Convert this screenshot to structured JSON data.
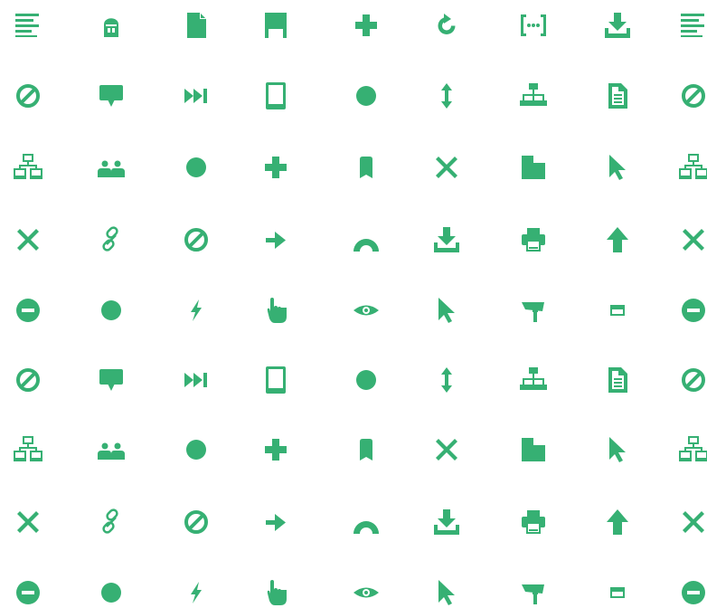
{
  "colors": {
    "icon": "#36b073",
    "background": "#ffffff"
  },
  "grid": {
    "rows": [
      [
        "align-left-icon",
        "robot-head-icon",
        "file-icon",
        "flag-icon",
        "plus-icon",
        "refresh-icon",
        "json-brackets-icon",
        "download-icon",
        "align-left-icon"
      ],
      [
        "ban-icon",
        "speech-bubble-icon",
        "fast-forward-icon",
        "tablet-icon",
        "circle-icon",
        "vertical-resize-icon",
        "sitemap-icon",
        "document-text-icon",
        "ban-icon"
      ],
      [
        "network-icon",
        "group-icon",
        "circle-icon",
        "plus-icon",
        "bookmark-icon",
        "close-icon",
        "folder-file-icon",
        "cursor-icon",
        "network-icon"
      ],
      [
        "close-icon",
        "link-icon",
        "ban-icon",
        "arrow-right-icon",
        "opencart-icon",
        "download-icon",
        "printer-icon",
        "arrow-up-icon",
        "close-icon"
      ],
      [
        "minus-circle-icon",
        "circle-icon",
        "flash-icon",
        "hand-pointer-icon",
        "eye-icon",
        "cursor-icon",
        "security-camera-icon",
        "window-icon",
        "minus-circle-icon"
      ],
      [
        "ban-icon",
        "speech-bubble-icon",
        "fast-forward-icon",
        "tablet-icon",
        "circle-icon",
        "vertical-resize-icon",
        "sitemap-icon",
        "document-text-icon",
        "ban-icon"
      ],
      [
        "network-icon",
        "group-icon",
        "circle-icon",
        "plus-icon",
        "bookmark-icon",
        "close-icon",
        "folder-file-icon",
        "cursor-icon",
        "network-icon"
      ],
      [
        "close-icon",
        "link-icon",
        "ban-icon",
        "arrow-right-icon",
        "opencart-icon",
        "download-icon",
        "printer-icon",
        "arrow-up-icon",
        "close-icon"
      ],
      [
        "minus-circle-icon",
        "circle-icon",
        "flash-icon",
        "hand-pointer-icon",
        "eye-icon",
        "cursor-icon",
        "security-camera-icon",
        "window-icon",
        "minus-circle-icon"
      ]
    ]
  }
}
